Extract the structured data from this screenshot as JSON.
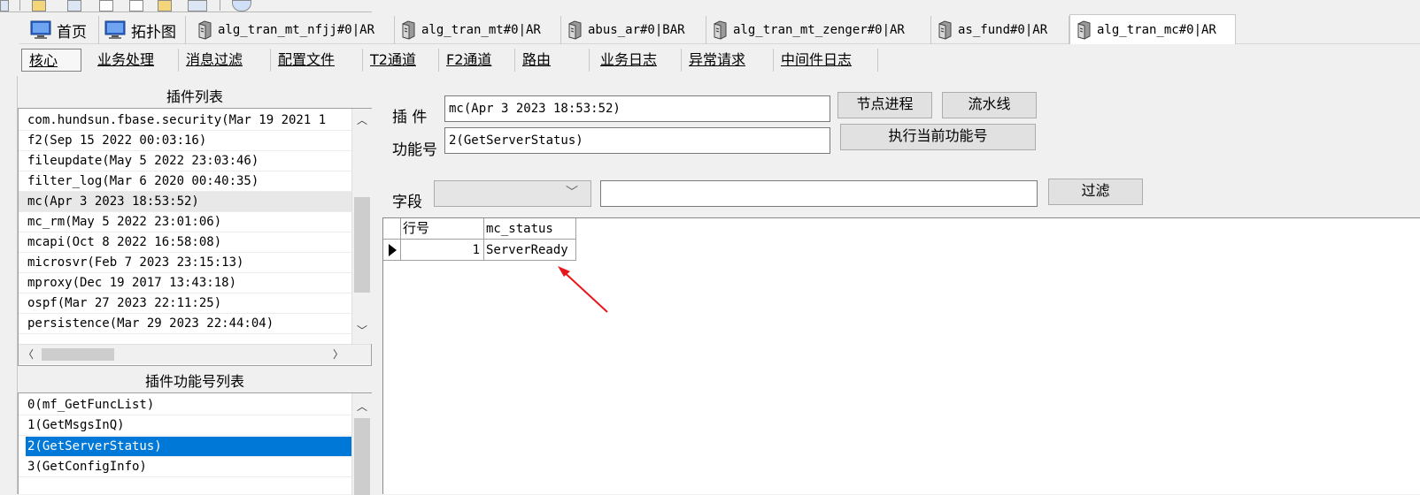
{
  "tabs": [
    {
      "label": "首页",
      "icon": "monitor-icon"
    },
    {
      "label": "拓扑图",
      "icon": "monitor-icon"
    },
    {
      "label": "alg_tran_mt_nfjj#0|AR",
      "icon": "server-icon"
    },
    {
      "label": "alg_tran_mt#0|AR",
      "icon": "server-icon"
    },
    {
      "label": "abus_ar#0|BAR",
      "icon": "server-icon"
    },
    {
      "label": "alg_tran_mt_zenger#0|AR",
      "icon": "server-icon"
    },
    {
      "label": "as_fund#0|AR",
      "icon": "server-icon"
    },
    {
      "label": "alg_tran_mc#0|AR",
      "icon": "server-icon",
      "active": true
    }
  ],
  "subnav": [
    "核心",
    "业务处理",
    "消息过滤",
    "配置文件",
    "T2通道",
    "F2通道",
    "路由",
    "业务日志",
    "异常请求",
    "中间件日志"
  ],
  "plugin_list": {
    "title": "插件列表",
    "items": [
      "com.hundsun.fbase.security(Mar 19 2021  1",
      "f2(Sep 15 2022 00:03:16)",
      "fileupdate(May  5 2022 23:03:46)",
      "filter_log(Mar  6 2020 00:40:35)",
      "mc(Apr  3 2023 18:53:52)",
      "mc_rm(May  5 2022 23:01:06)",
      "mcapi(Oct  8 2022 16:58:08)",
      "microsvr(Feb  7 2023 23:15:13)",
      "mproxy(Dec 19 2017 13:43:18)",
      "ospf(Mar 27 2023 22:11:25)",
      "persistence(Mar 29 2023 22:44:04)"
    ],
    "selected_index": 4
  },
  "function_list": {
    "title": "插件功能号列表",
    "items": [
      "0(mf_GetFuncList)",
      "1(GetMsgsInQ)",
      "2(GetServerStatus)",
      "3(GetConfigInfo)"
    ],
    "selected_index": 2
  },
  "form": {
    "plugin_label": "插 件",
    "plugin_value": "mc(Apr  3 2023 18:53:52)",
    "func_label": "功能号",
    "func_value": "2(GetServerStatus)",
    "field_label": "字段",
    "field_value": "",
    "filter_value": "",
    "node_process_btn": "节点进程",
    "pipeline_btn": "流水线",
    "execute_btn": "执行当前功能号",
    "filter_btn": "过滤"
  },
  "grid": {
    "columns": [
      "行号",
      "mc_status"
    ],
    "rows": [
      {
        "row_no": "1",
        "mc_status": "ServerReady"
      }
    ]
  },
  "colors": {
    "selection": "#0078d7",
    "annotation_arrow": "#e8161b"
  }
}
